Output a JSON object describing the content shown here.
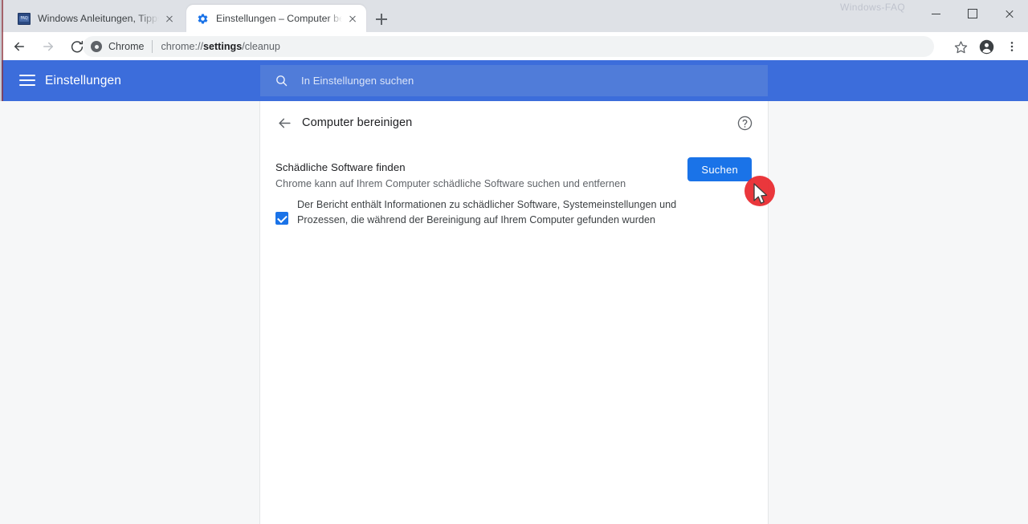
{
  "window": {
    "watermark": "Windows-FAQ",
    "controls": {
      "minimize": "Minimieren",
      "maximize": "Maximieren",
      "close": "Schließen"
    }
  },
  "tabs": [
    {
      "title": "Windows Anleitungen, Tipps & Tricks",
      "favicon": "faq-site-icon",
      "active": false
    },
    {
      "title": "Einstellungen – Computer bereinigen",
      "favicon": "chrome-settings-gear-icon",
      "active": true
    }
  ],
  "new_tab_label": "Neuer Tab",
  "toolbar": {
    "back_label": "Zurück",
    "forward_label": "Vorwärts",
    "reload_label": "Neu laden",
    "chrome_badge": "Chrome",
    "url_prefix": "chrome://",
    "url_bold": "settings",
    "url_suffix": "/cleanup",
    "url_full": "chrome://settings/cleanup",
    "bookmark_label": "Lesezeichen setzen",
    "profile_label": "Profil",
    "menu_label": "Chrome anpassen und einstellen"
  },
  "settings_header": {
    "menu_label": "Hauptmenü",
    "title": "Einstellungen",
    "search_placeholder": "In Einstellungen suchen",
    "background_color": "#3c6ddb"
  },
  "page": {
    "back_label": "Zurück",
    "title": "Computer bereinigen",
    "help_label": "Hilfe",
    "section": {
      "title": "Schädliche Software finden",
      "subtitle": "Chrome kann auf Ihrem Computer schädliche Software suchen und entfernen",
      "button_label": "Suchen",
      "button_color": "#1a73e8"
    },
    "checkbox": {
      "checked": true,
      "label": "Der Bericht enthält Informationen zu schädlicher Software, Systemeinstellungen und Prozessen, die während der Bereinigung auf Ihrem Computer gefunden wurden",
      "color": "#1a73e8"
    }
  },
  "annotation": {
    "click_marker_color": "#e8262b",
    "cursor": "mouse-pointer"
  }
}
